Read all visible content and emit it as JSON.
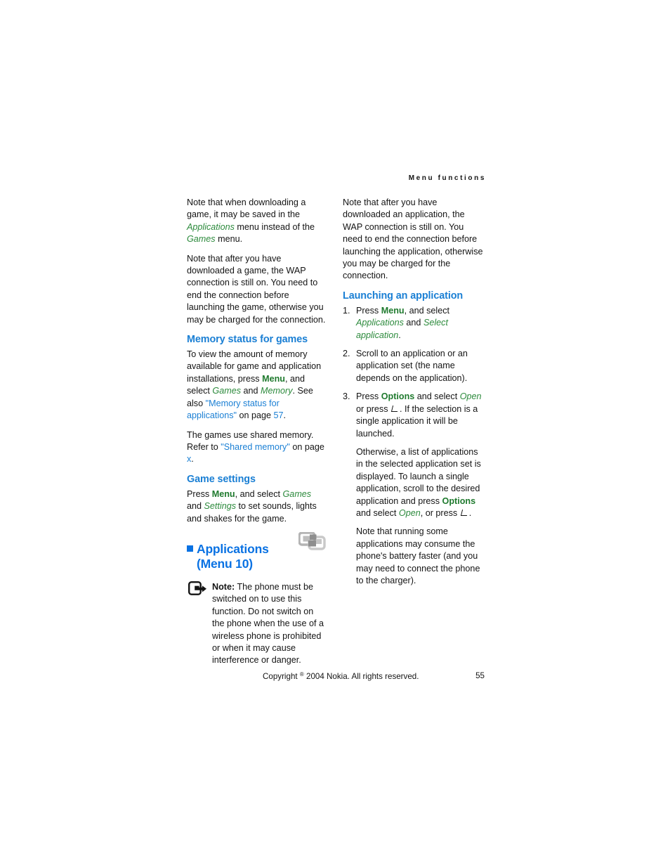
{
  "document": {
    "running_header": "Menu functions",
    "footer": {
      "copyright_prefix": "Copyright",
      "copyright_symbol": "®",
      "copyright_rest": "2004 Nokia. All rights reserved.",
      "page_number": "55"
    }
  },
  "colors": {
    "heading_blue": "#1a7fd4",
    "chapter_blue": "#0a72e3",
    "xref_blue": "#1a7fd4",
    "soft_key_green": "#1f7a2e",
    "menu_item_green": "#2c8a3c",
    "body_text": "#141414",
    "icon_grey": "#9a9a9a"
  },
  "left_column": {
    "para_download_game": {
      "t1": "Note that when downloading a game, it may be saved in the ",
      "menu1": "Applications",
      "t2": " menu instead of the ",
      "menu2": "Games",
      "t3": " menu."
    },
    "para_wap_game": "Note that after you have downloaded a game, the WAP connection is still on. You need to end the connection before launching the game, otherwise you may be charged for the connection.",
    "heading_memory_status": "Memory status for games",
    "para_memory_status": {
      "t1": "To view the amount of memory available for game and application installations, press ",
      "key1": "Menu",
      "t2": ", and select ",
      "menu1": "Games",
      "t3": " and ",
      "menu2": "Memory",
      "t4": ". See also ",
      "xref": "\"Memory status for applications\"",
      "t5": " on page ",
      "xref_page": "57",
      "t6": "."
    },
    "para_shared_memory": {
      "t1": "The games use shared memory. Refer to ",
      "xref": "\"Shared memory\"",
      "t2": " on page ",
      "xref_page": "x",
      "t3": "."
    },
    "heading_game_settings": "Game settings",
    "para_game_settings": {
      "t1": "Press ",
      "key1": "Menu",
      "t2": ", and select ",
      "menu1": "Games",
      "t3": " and ",
      "menu2": "Settings",
      "t4": " to set sounds, lights and shakes for the game."
    },
    "chapter_heading": {
      "line1": "Applications",
      "line2": "(Menu 10)",
      "icon": "applications-icon"
    },
    "note": {
      "icon": "note-arrow-icon",
      "label": "Note:",
      "text": " The phone must be switched on to use this function. Do not switch on the phone when the use of a wireless phone is prohibited or when it may cause interference or danger."
    }
  },
  "right_column": {
    "para_wap_application": "Note that after you have downloaded an application, the WAP connection is still on. You need to end the connection before launching the application, otherwise you may be charged for the connection.",
    "heading_launching": "Launching an application",
    "steps": [
      {
        "number": "1.",
        "t1": "Press ",
        "key1": "Menu",
        "t2": ", and select ",
        "menu1": "Applications",
        "t3": " and ",
        "menu2": "Select application",
        "t4": "."
      },
      {
        "number": "2.",
        "t1": "Scroll to an application or an application set (the name depends on the application)."
      },
      {
        "number": "3.",
        "t1": "Press ",
        "key1": "Options",
        "t2": " and select ",
        "menu1": "Open",
        "t3": " or press ",
        "glyph": "select-key-glyph",
        "t4": ". If the selection is a single application it will be launched.",
        "sub1": {
          "t1": "Otherwise, a list of applications in the selected application set is displayed. To launch a single application, scroll to the desired application and press ",
          "key1": "Options",
          "t2": " and select ",
          "menu1": "Open",
          "t3": ", or press ",
          "glyph": "select-key-glyph",
          "t4": "."
        },
        "sub2": "Note that running some applications may consume the phone's battery faster (and you may need to connect the phone to the charger)."
      }
    ]
  }
}
